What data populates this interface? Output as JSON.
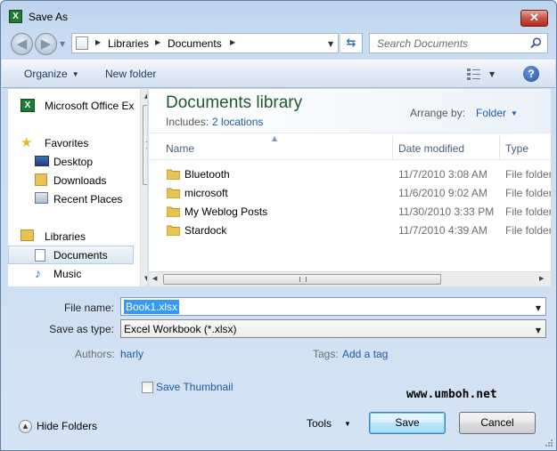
{
  "window": {
    "title": "Save As",
    "app_icon": "excel-icon",
    "close_label": "✕"
  },
  "nav": {
    "back_icon": "back-arrow-icon",
    "forward_icon": "forward-arrow-icon",
    "path": [
      "Libraries",
      "Documents"
    ],
    "search_placeholder": "Search Documents"
  },
  "toolbar": {
    "organize_label": "Organize",
    "new_folder_label": "New folder",
    "views_icon": "views-icon",
    "help_label": "?"
  },
  "sidebar": {
    "items": [
      {
        "label": "Microsoft Office Ex",
        "icon": "excel-icon"
      },
      {
        "label": "Favorites",
        "icon": "star-icon"
      },
      {
        "label": "Desktop",
        "icon": "desktop-icon"
      },
      {
        "label": "Downloads",
        "icon": "downloads-icon"
      },
      {
        "label": "Recent Places",
        "icon": "recent-places-icon"
      },
      {
        "label": "Libraries",
        "icon": "libraries-icon"
      },
      {
        "label": "Documents",
        "icon": "document-icon"
      },
      {
        "label": "Music",
        "icon": "music-icon"
      }
    ]
  },
  "library": {
    "title": "Documents library",
    "includes_label": "Includes:",
    "includes_link": "2 locations",
    "arrange_label": "Arrange by:",
    "arrange_value": "Folder"
  },
  "columns": {
    "name": "Name",
    "date": "Date modified",
    "type": "Type"
  },
  "files": [
    {
      "name": "Bluetooth",
      "date": "11/7/2010 3:08 AM",
      "type": "File folder"
    },
    {
      "name": "microsoft",
      "date": "11/6/2010 9:02 AM",
      "type": "File folder"
    },
    {
      "name": "My Weblog Posts",
      "date": "11/30/2010 3:33 PM",
      "type": "File folder"
    },
    {
      "name": "Stardock",
      "date": "11/7/2010 4:39 AM",
      "type": "File folder"
    }
  ],
  "form": {
    "file_name_label": "File name:",
    "file_name_value": "Book1.xlsx",
    "save_type_label": "Save as type:",
    "save_type_value": "Excel Workbook (*.xlsx)",
    "authors_label": "Authors:",
    "authors_value": "harly",
    "tags_label": "Tags:",
    "tags_value": "Add a tag",
    "thumbnail_label": "Save Thumbnail",
    "thumbnail_checked": false
  },
  "footer": {
    "hide_folders_label": "Hide Folders",
    "tools_label": "Tools",
    "save_label": "Save",
    "cancel_label": "Cancel",
    "watermark": "www.umboh.net"
  },
  "colors": {
    "title_green": "#1e5a2d",
    "link_blue": "#1c5aa6",
    "folder_yellow": "#e8c352",
    "selection_blue": "#3399ff"
  }
}
